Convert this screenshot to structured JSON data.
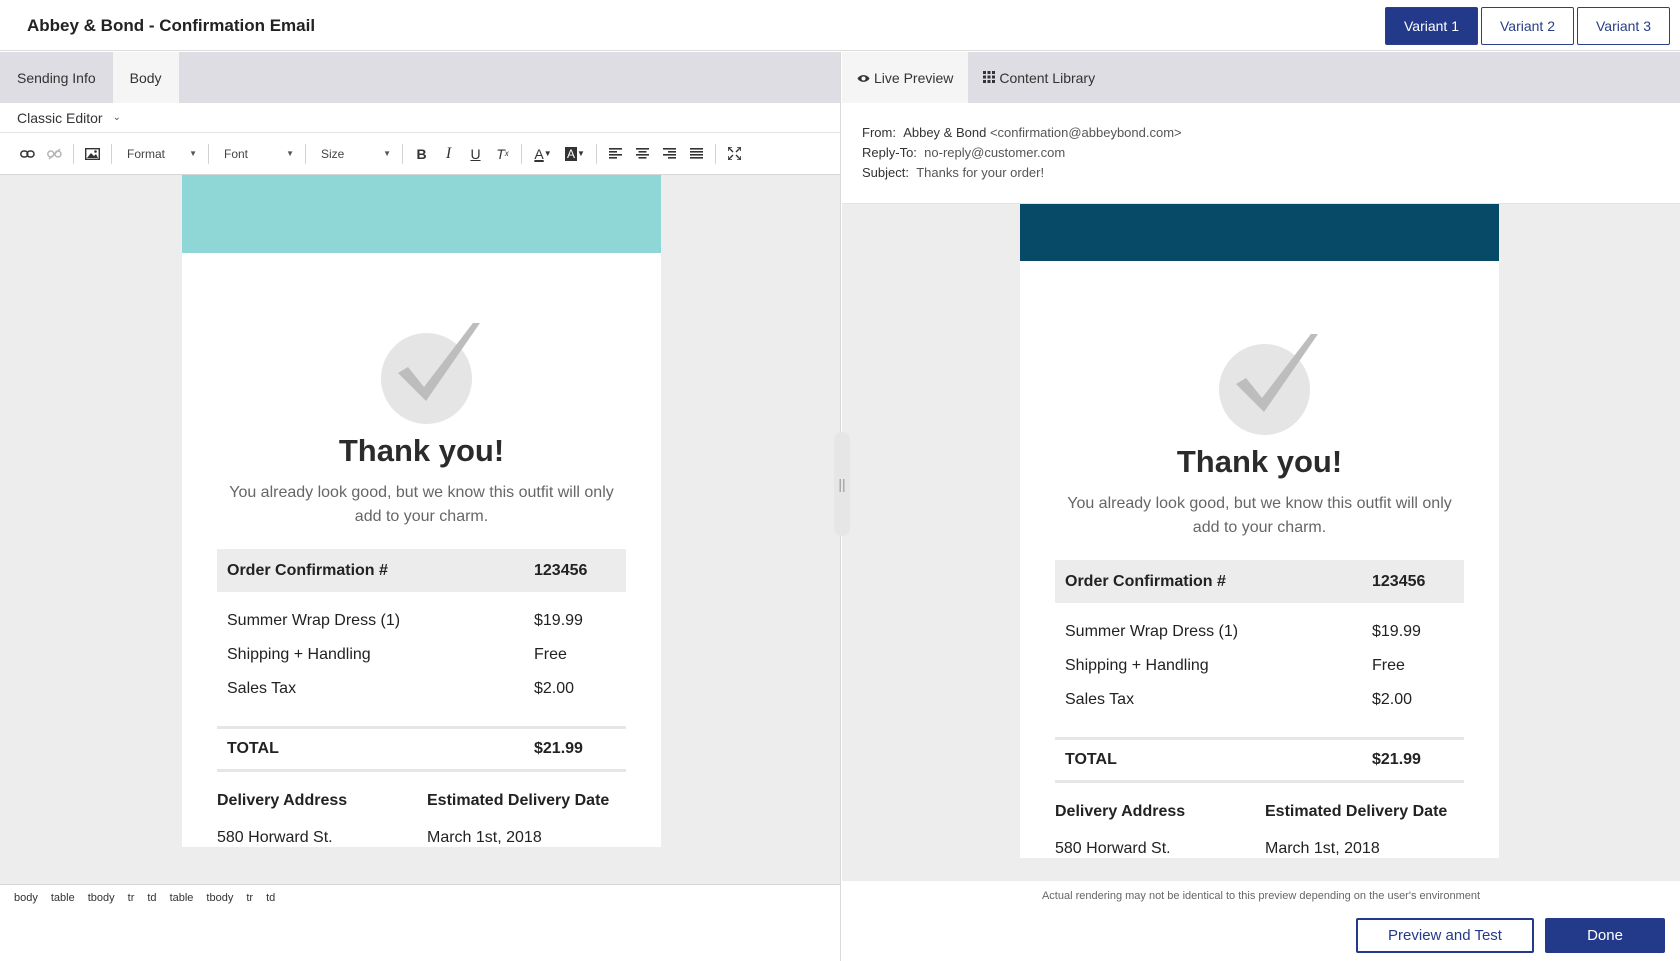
{
  "header": {
    "title": "Abbey & Bond - Confirmation Email",
    "variants": [
      "Variant 1",
      "Variant 2",
      "Variant 3"
    ],
    "active_variant": "Variant 1"
  },
  "editor": {
    "tabs": [
      "Sending Info",
      "Body"
    ],
    "active_tab": "Body",
    "mode": "Classic Editor",
    "toolbar": {
      "format_label": "Format",
      "font_label": "Font",
      "size_label": "Size",
      "icons": [
        "link-icon",
        "unlink-icon",
        "image-icon",
        "bold-icon",
        "italic-icon",
        "underline-icon",
        "clear-format-icon",
        "text-color-icon",
        "bg-color-icon",
        "align-left-icon",
        "align-center-icon",
        "align-right-icon",
        "justify-icon",
        "maximize-icon"
      ]
    },
    "statusbar": [
      "body",
      "table",
      "tbody",
      "tr",
      "td",
      "table",
      "tbody",
      "tr",
      "td"
    ]
  },
  "preview": {
    "tabs": [
      "Live Preview",
      "Content Library"
    ],
    "active_tab": "Live Preview",
    "from_label": "From:",
    "from_name": "Abbey & Bond",
    "from_email": "<confirmation@abbeybond.com>",
    "replyto_label": "Reply-To:",
    "replyto_value": "no-reply@customer.com",
    "subject_label": "Subject:",
    "subject_value": "Thanks for your order!",
    "disclaimer": "Actual rendering may not be identical to this preview depending on the user's environment"
  },
  "email": {
    "heading": "Thank you!",
    "lead": "You already look good, but we know this outfit will only add to your charm.",
    "order_label": "Order Confirmation #",
    "order_number": "123456",
    "items": [
      {
        "name": "Summer Wrap Dress (1)",
        "value": "$19.99"
      },
      {
        "name": "Shipping + Handling",
        "value": "Free"
      },
      {
        "name": "Sales Tax",
        "value": "$2.00"
      }
    ],
    "total_label": "TOTAL",
    "total_value": "$21.99",
    "delivery_label": "Delivery Address",
    "delivery_value": "580 Horward St.",
    "est_label": "Estimated Delivery Date",
    "est_value": "March 1st, 2018"
  },
  "colors": {
    "primary": "#233a8a",
    "left_band": "#8fd6d6",
    "right_band": "#064a68"
  },
  "footer": {
    "preview_test": "Preview and Test",
    "done": "Done"
  }
}
